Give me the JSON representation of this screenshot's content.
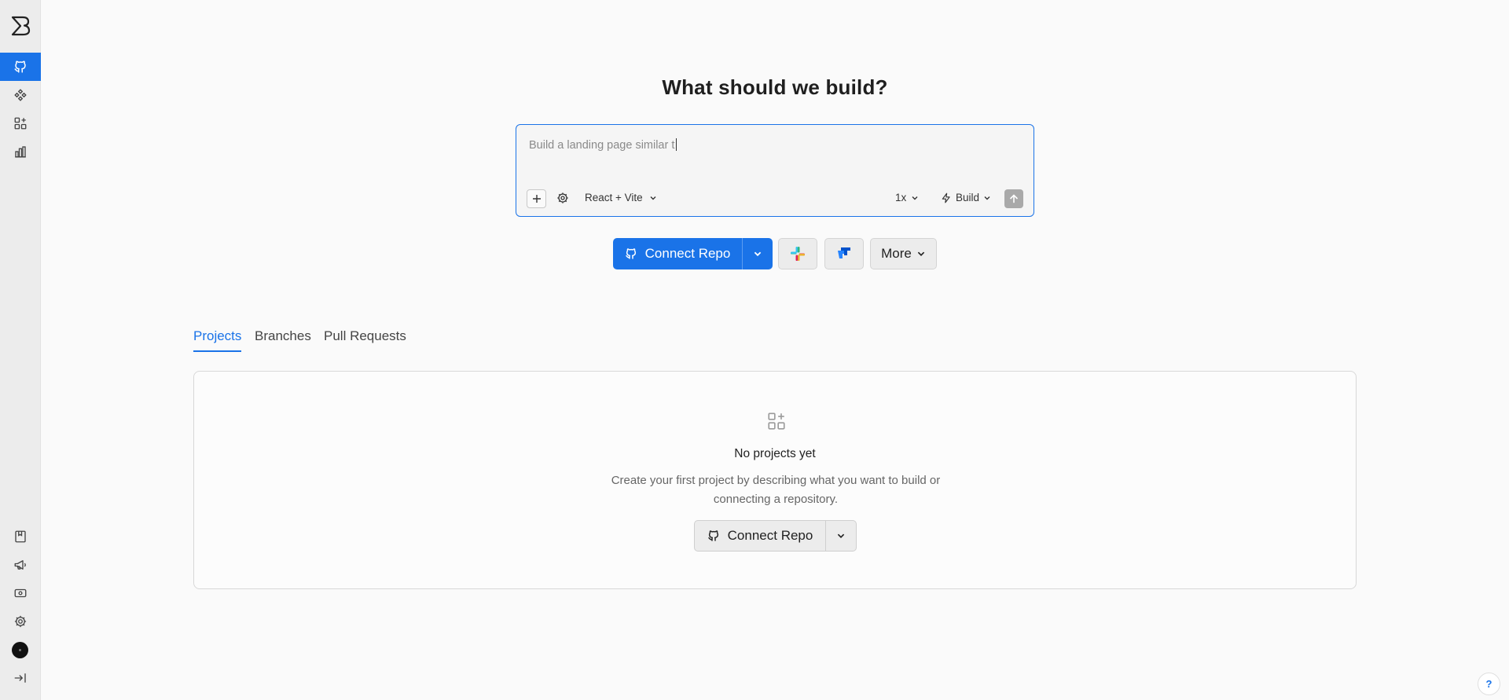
{
  "sidebar": {
    "logo_icon": "brand-logo-icon",
    "nav": [
      {
        "icon": "github-icon",
        "active": true
      },
      {
        "icon": "components-icon",
        "active": false
      },
      {
        "icon": "apps-add-icon",
        "active": false
      },
      {
        "icon": "chart-bar-icon",
        "active": false
      }
    ],
    "bottom": [
      {
        "icon": "book-icon"
      },
      {
        "icon": "megaphone-icon"
      },
      {
        "icon": "payment-icon"
      },
      {
        "icon": "gear-icon"
      },
      {
        "icon": "avatar"
      },
      {
        "icon": "collapse-sidebar-icon"
      }
    ]
  },
  "main": {
    "title": "What should we build?",
    "prompt": {
      "value": "Build a landing page similar t",
      "framework": "React + Vite",
      "multiplier": "1x",
      "mode": "Build"
    },
    "actions": {
      "connect_repo": "Connect Repo",
      "more": "More"
    },
    "tabs": [
      {
        "label": "Projects",
        "active": true
      },
      {
        "label": "Branches",
        "active": false
      },
      {
        "label": "Pull Requests",
        "active": false
      }
    ],
    "empty_state": {
      "title": "No projects yet",
      "description": "Create your first project by describing what you want to build or connecting a repository.",
      "button": "Connect Repo"
    },
    "help": "?"
  },
  "colors": {
    "accent": "#1a73e8",
    "sidebar_bg": "#ececec",
    "page_bg": "#fafafa"
  }
}
